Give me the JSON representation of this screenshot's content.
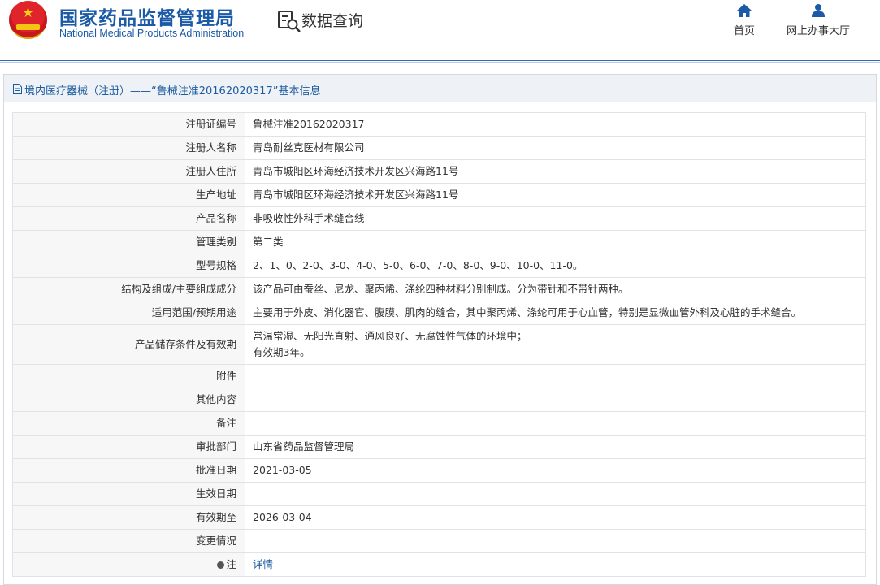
{
  "header": {
    "org_name_cn": "国家药品监督管理局",
    "org_name_en": "National Medical Products Administration",
    "section_title": "数据查询",
    "nav": [
      {
        "label": "首页",
        "icon": "home-icon"
      },
      {
        "label": "网上办事大厅",
        "icon": "user-icon"
      }
    ]
  },
  "colors": {
    "brand_blue": "#1a5aa6",
    "link_blue": "#1d5c9f",
    "label_bg": "#f7f7f7",
    "panel_head_bg": "#eef2f6"
  },
  "panel": {
    "title": "境内医疗器械（注册）——“鲁械注准20162020317”基本信息"
  },
  "rows": [
    {
      "label": "注册证编号",
      "value": "鲁械注准20162020317"
    },
    {
      "label": "注册人名称",
      "value": "青岛耐丝克医材有限公司"
    },
    {
      "label": "注册人住所",
      "value": "青岛市城阳区环海经济技术开发区兴海路11号"
    },
    {
      "label": "生产地址",
      "value": "青岛市城阳区环海经济技术开发区兴海路11号"
    },
    {
      "label": "产品名称",
      "value": "非吸收性外科手术缝合线"
    },
    {
      "label": "管理类别",
      "value": "第二类"
    },
    {
      "label": "型号规格",
      "value": "2、1、0、2-0、3-0、4-0、5-0、6-0、7-0、8-0、9-0、10-0、11-0。"
    },
    {
      "label": "结构及组成/主要组成成分",
      "value": "该产品可由蚕丝、尼龙、聚丙烯、涤纶四种材料分别制成。分为带针和不带针两种。"
    },
    {
      "label": "适用范围/预期用途",
      "value": "主要用于外皮、消化器官、腹膜、肌肉的缝合，其中聚丙烯、涤纶可用于心血管，特别是显微血管外科及心脏的手术缝合。"
    },
    {
      "label": "产品储存条件及有效期",
      "value_line1": "常温常湿、无阳光直射、通风良好、无腐蚀性气体的环境中；",
      "value_line2": "有效期3年。"
    },
    {
      "label": "附件",
      "value": ""
    },
    {
      "label": "其他内容",
      "value": ""
    },
    {
      "label": "备注",
      "value": ""
    },
    {
      "label": "审批部门",
      "value": "山东省药品监督管理局"
    },
    {
      "label": "批准日期",
      "value": "2021-03-05"
    },
    {
      "label": "生效日期",
      "value": ""
    },
    {
      "label": "有效期至",
      "value": "2026-03-04"
    },
    {
      "label": "变更情况",
      "value": ""
    },
    {
      "label": "注",
      "value": "详情"
    }
  ]
}
